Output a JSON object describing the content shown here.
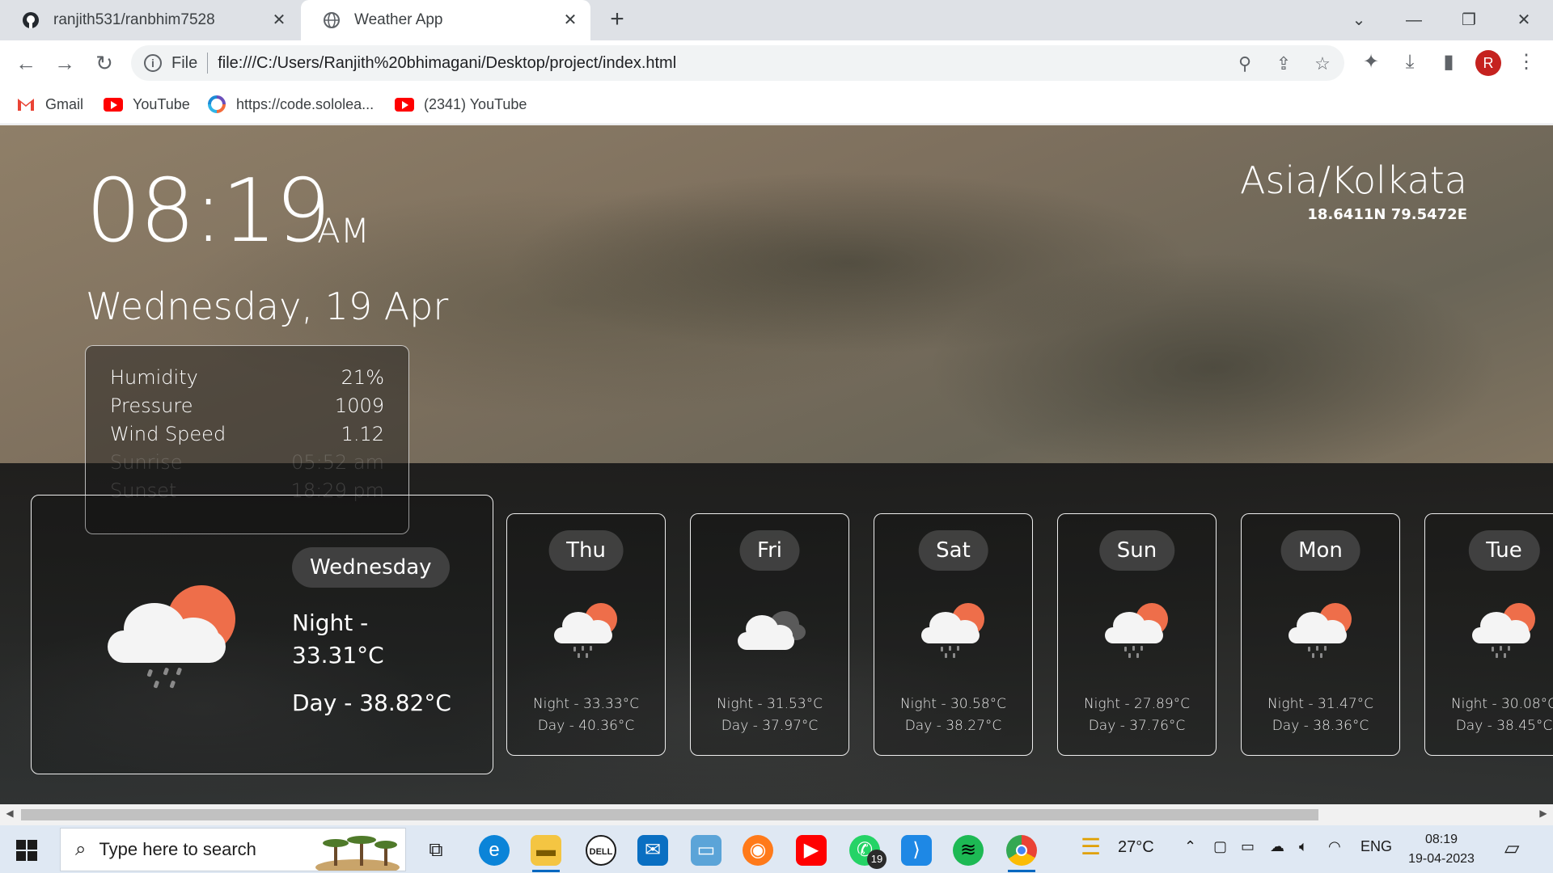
{
  "browser": {
    "tabs": [
      {
        "title": "ranjith531/ranbhim7528"
      },
      {
        "title": "Weather App"
      }
    ],
    "url_scheme": "File",
    "url": "file:///C:/Users/Ranjith%20bhimagani/Desktop/project/index.html",
    "profile_initial": "R",
    "bookmarks": [
      {
        "label": "Gmail"
      },
      {
        "label": "YouTube"
      },
      {
        "label": "https://code.sololea..."
      },
      {
        "label": "(2341) YouTube"
      }
    ]
  },
  "weather": {
    "time": "08:19",
    "ampm": "AM",
    "date": "Wednesday, 19 Apr",
    "timezone": "Asia/Kolkata",
    "coords": "18.6411N 79.5472E",
    "details": [
      {
        "label": "Humidity",
        "value": "21%"
      },
      {
        "label": "Pressure",
        "value": "1009"
      },
      {
        "label": "Wind Speed",
        "value": "1.12"
      },
      {
        "label": "Sunrise",
        "value": "05:52 am"
      },
      {
        "label": "Sunset",
        "value": "18:29 pm"
      }
    ],
    "today": {
      "day": "Wednesday",
      "night": "Night - 33.31°C",
      "daytemp": "Day - 38.82°C",
      "icon": "rain-cloud-sun-icon"
    },
    "forecast": [
      {
        "day": "Thu",
        "night": "Night - 33.33°C",
        "daytemp": "Day - 40.36°C",
        "icon": "rain-cloud-sun-icon"
      },
      {
        "day": "Fri",
        "night": "Night - 31.53°C",
        "daytemp": "Day - 37.97°C",
        "icon": "cloudy-icon"
      },
      {
        "day": "Sat",
        "night": "Night - 30.58°C",
        "daytemp": "Day - 38.27°C",
        "icon": "rain-cloud-sun-icon"
      },
      {
        "day": "Sun",
        "night": "Night - 27.89°C",
        "daytemp": "Day - 37.76°C",
        "icon": "rain-cloud-sun-icon"
      },
      {
        "day": "Mon",
        "night": "Night - 31.47°C",
        "daytemp": "Day - 38.36°C",
        "icon": "rain-cloud-sun-icon"
      },
      {
        "day": "Tue",
        "night": "Night - 30.08°C",
        "daytemp": "Day - 38.45°C",
        "icon": "rain-cloud-sun-icon"
      }
    ]
  },
  "taskbar": {
    "search_placeholder": "Type here to search",
    "whatsapp_badge": "19",
    "weather_temp": "27°C",
    "language": "ENG",
    "clock_time": "08:19",
    "clock_date": "19-04-2023"
  },
  "colors": {
    "sun": "#ee6e4a",
    "cloud": "#f4f4f4",
    "dark_cloud": "#5a5a5a",
    "tab_bar": "#dee1e6"
  }
}
